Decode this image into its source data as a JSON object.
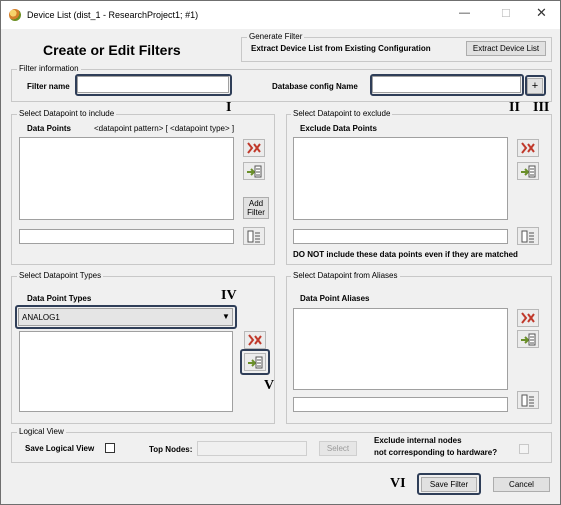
{
  "window": {
    "title": "Device List (dist_1 - ResearchProject1; #1)"
  },
  "header": {
    "heading": "Create or Edit Filters"
  },
  "generate_filter": {
    "legend": "Generate Filter",
    "description": "Extract Device List from Existing Configuration",
    "button_label": "Extract Device List"
  },
  "filter_info": {
    "legend": "Filter information",
    "filter_name_label": "Filter name",
    "filter_name_value": "",
    "db_config_label": "Database config Name",
    "db_config_value": "",
    "add_button": "+"
  },
  "include": {
    "legend": "Select Datapoint to include",
    "heading": "Data Points",
    "pattern_hint": "<datapoint pattern> [ <datapoint type> ]",
    "add_filter_label": "Add Filter",
    "input_value": ""
  },
  "exclude": {
    "legend": "Select Datapoint to exclude",
    "heading": "Exclude Data Points",
    "note": "DO NOT include these data points even if they are matched",
    "input_value": ""
  },
  "types": {
    "legend": "Select Datapoint Types",
    "heading": "Data Point Types",
    "selected": "ANALOG1"
  },
  "aliases": {
    "legend": "Select Datapoint from Aliases",
    "heading": "Data Point Aliases",
    "input_value": ""
  },
  "logical_view": {
    "legend": "Logical View",
    "save_label": "Save Logical View",
    "top_nodes_label": "Top Nodes:",
    "select_button": "Select",
    "exclude_label_line1": "Exclude internal nodes",
    "exclude_label_line2": "not corresponding to hardware?"
  },
  "footer": {
    "save_button": "Save Filter",
    "cancel_button": "Cancel"
  },
  "annotations": {
    "i": "I",
    "ii": "II",
    "iii": "III",
    "iv": "IV",
    "v": "V",
    "vi": "VI"
  },
  "icons": [
    "remove-icon",
    "add-to-list-icon",
    "list-picker-icon",
    "dropdown-arrow-icon",
    "minimize-icon",
    "maximize-icon",
    "close-icon"
  ],
  "colors": {
    "highlight": "#2f3e58",
    "window_bg": "#f0f0f0",
    "remove_x": "#c0392b"
  }
}
